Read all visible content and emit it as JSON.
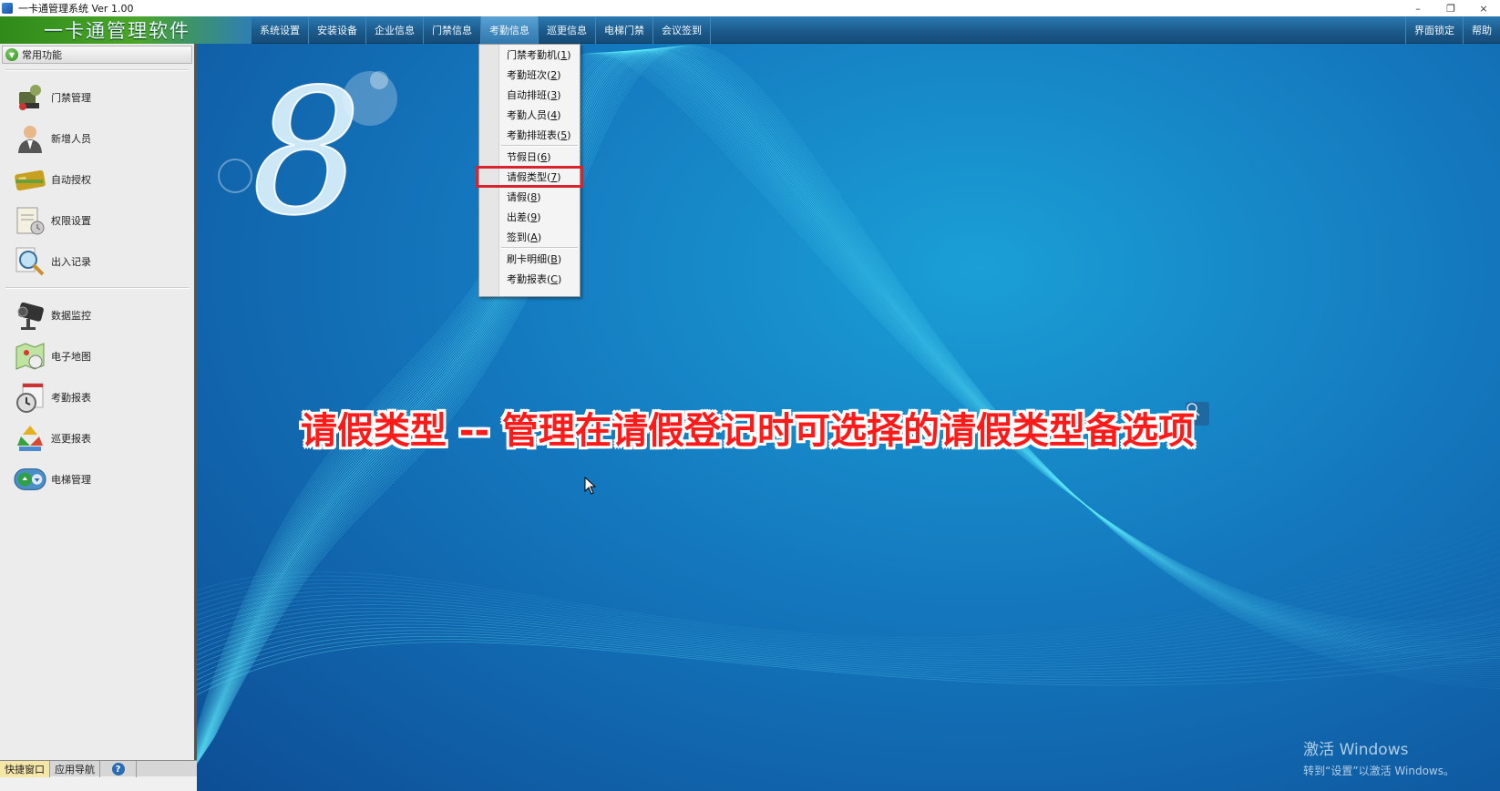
{
  "window": {
    "title": "一卡通管理系统  Ver 1.00",
    "controls": [
      "–",
      "❐",
      "×"
    ]
  },
  "header": {
    "brand": "一卡通管理软件",
    "menu": [
      {
        "label": "系统设置"
      },
      {
        "label": "安装设备"
      },
      {
        "label": "企业信息"
      },
      {
        "label": "门禁信息"
      },
      {
        "label": "考勤信息",
        "active": true
      },
      {
        "label": "巡更信息"
      },
      {
        "label": "电梯门禁"
      },
      {
        "label": "会议签到"
      }
    ],
    "right": [
      "界面锁定",
      "帮助"
    ]
  },
  "sidebar": {
    "title": "常用功能",
    "group1": [
      {
        "label": "门禁管理",
        "icon": "door-control-icon"
      },
      {
        "label": "新增人员",
        "icon": "person-icon"
      },
      {
        "label": "自动授权",
        "icon": "card-icon"
      },
      {
        "label": "权限设置",
        "icon": "permission-icon"
      },
      {
        "label": "出入记录",
        "icon": "magnifier-icon"
      }
    ],
    "group2": [
      {
        "label": "数据监控",
        "icon": "camera-icon"
      },
      {
        "label": "电子地图",
        "icon": "map-icon"
      },
      {
        "label": "考勤报表",
        "icon": "clock-icon"
      },
      {
        "label": "巡更报表",
        "icon": "patrol-icon"
      },
      {
        "label": "电梯管理",
        "icon": "elevator-icon"
      }
    ],
    "tabs": [
      "快捷窗口",
      "应用导航",
      "?"
    ]
  },
  "dropdown": {
    "sections": [
      [
        {
          "label": "门禁考勤机",
          "key": "1"
        },
        {
          "label": "考勤班次",
          "key": "2"
        },
        {
          "label": "自动排班",
          "key": "3"
        },
        {
          "label": "考勤人员",
          "key": "4"
        },
        {
          "label": "考勤排班表",
          "key": "5"
        }
      ],
      [
        {
          "label": "节假日",
          "key": "6"
        },
        {
          "label": "请假类型",
          "key": "7",
          "highlighted": true
        },
        {
          "label": "请假",
          "key": "8"
        },
        {
          "label": "出差",
          "key": "9"
        },
        {
          "label": "签到",
          "key": "A"
        }
      ],
      [
        {
          "label": "刷卡明细",
          "key": "B"
        },
        {
          "label": "考勤报表",
          "key": "C"
        }
      ]
    ]
  },
  "main": {
    "caption": "请假类型 -- 管理在请假登记时可选择的请假类型备选项",
    "logo_digit": "8",
    "watermark": {
      "line1": "激活 Windows",
      "line2": "转到“设置”以激活 Windows。"
    }
  },
  "colors": {
    "highlight_border": "#d8242f",
    "caption_text": "#ff1a1a",
    "header_blue": "#1c5b8c",
    "brand_green": "#4aa628"
  }
}
